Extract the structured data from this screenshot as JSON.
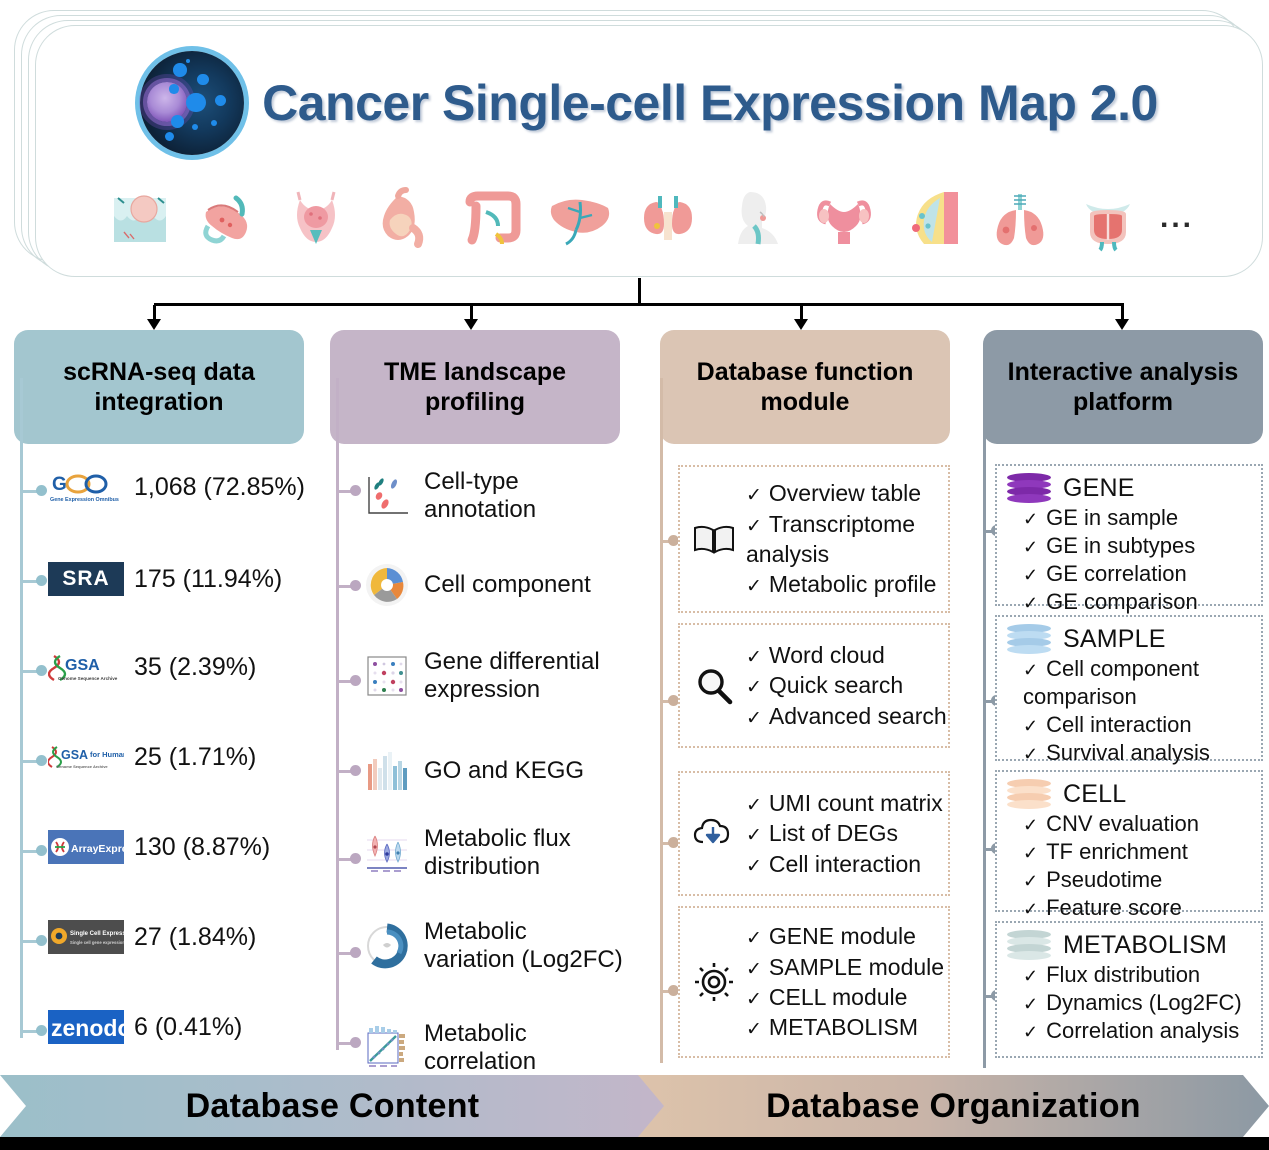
{
  "header": {
    "title": "Cancer Single-cell Expression Map 2.0",
    "logo_name": "cell-logo",
    "organs": [
      "skin",
      "pancreas",
      "bladder",
      "stomach",
      "colon",
      "liver",
      "kidney",
      "head-neck",
      "uterus",
      "breast",
      "lung",
      "prostate"
    ],
    "ellipsis": "..."
  },
  "columns": [
    {
      "id": "scrna",
      "title": "scRNA-seq data integration",
      "accent": "#a3c6cf",
      "rows": [
        {
          "source": "GEO",
          "logo_label": "GEO",
          "value": "1,068 (72.85%)"
        },
        {
          "source": "SRA",
          "logo_label": "SRA",
          "value": "175 (11.94%)"
        },
        {
          "source": "GSA",
          "logo_label": "GSA",
          "value": "35 (2.39%)"
        },
        {
          "source": "GSA for Human",
          "logo_label": "GSA for Human",
          "value": "25 (1.71%)"
        },
        {
          "source": "ArrayExpress",
          "logo_label": "ArrayExpress",
          "value": "130 (8.87%)"
        },
        {
          "source": "Single Cell Expression Atlas",
          "logo_label": "Single Cell Expression Atlas",
          "value": "27 (1.84%)"
        },
        {
          "source": "zenodo",
          "logo_label": "zenodo",
          "value": "6 (0.41%)"
        }
      ]
    },
    {
      "id": "tme",
      "title": "TME landscape profiling",
      "accent": "#c5b5c8",
      "items": [
        {
          "icon": "scatter-plot-icon",
          "label": "Cell-type annotation"
        },
        {
          "icon": "pie-chart-icon",
          "label": "Cell component"
        },
        {
          "icon": "heatmap-icon",
          "label": "Gene differential expression"
        },
        {
          "icon": "bar-chart-icon",
          "label": "GO and KEGG"
        },
        {
          "icon": "violin-plot-icon",
          "label": "Metabolic flux distribution"
        },
        {
          "icon": "circos-icon",
          "label": "Metabolic variation (Log2FC)"
        },
        {
          "icon": "correlation-plot-icon",
          "label": "Metabolic correlation"
        }
      ]
    },
    {
      "id": "dbfunc",
      "title": "Database function module",
      "accent": "#dbc5b4",
      "cards": [
        {
          "icon": "book-icon",
          "items": [
            "Overview table",
            "Transcriptome analysis",
            "Metabolic profile"
          ]
        },
        {
          "icon": "search-icon",
          "items": [
            "Word cloud",
            "Quick search",
            "Advanced search"
          ]
        },
        {
          "icon": "download-cloud-icon",
          "items": [
            "UMI count matrix",
            "List of DEGs",
            "Cell interaction"
          ]
        },
        {
          "icon": "gear-icon",
          "items": [
            "GENE module",
            "SAMPLE module",
            "CELL module",
            "METABOLISM"
          ]
        }
      ]
    },
    {
      "id": "platform",
      "title": "Interactive analysis platform",
      "accent": "#8d9aa6",
      "modules": [
        {
          "name": "GENE",
          "icon": "database-icon",
          "color": "#7d29a8",
          "items": [
            "GE in sample",
            "GE in subtypes",
            "GE correlation",
            "GE comparison"
          ]
        },
        {
          "name": "SAMPLE",
          "icon": "database-icon",
          "color": "#a5cbe8",
          "items": [
            "Cell component comparison",
            "Cell interaction",
            "Survival analysis"
          ]
        },
        {
          "name": "CELL",
          "icon": "database-icon",
          "color": "#f6cdb0",
          "items": [
            "CNV evaluation",
            "TF enrichment",
            "Pseudotime",
            "Feature score"
          ]
        },
        {
          "name": "METABOLISM",
          "icon": "database-icon",
          "color": "#c3d5d4",
          "items": [
            "Flux distribution",
            "Dynamics (Log2FC)",
            "Correlation analysis"
          ]
        }
      ]
    }
  ],
  "banner": {
    "left_label": "Database Content",
    "right_label": "Database Organization"
  },
  "check_glyph": "✓"
}
